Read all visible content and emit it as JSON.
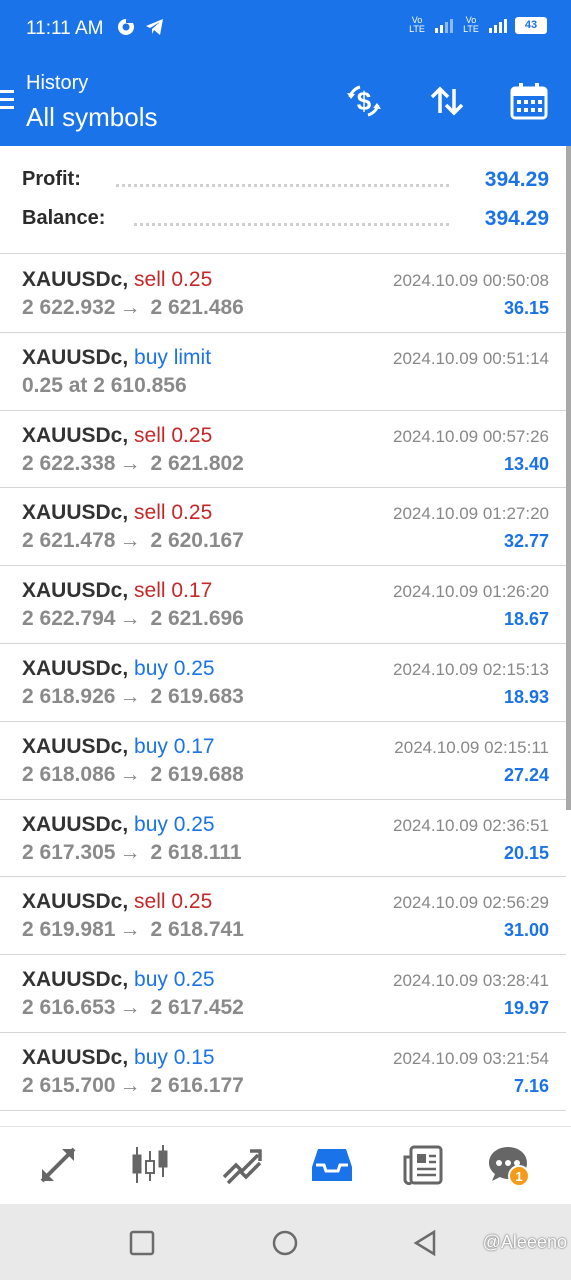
{
  "status_bar": {
    "time": "11:11 AM",
    "volte1": "Vo LTE",
    "volte2": "Vo LTE",
    "battery": "43"
  },
  "header": {
    "subtitle": "History",
    "title": "All symbols",
    "actions": [
      "dollar-refresh-icon",
      "sort-icon",
      "calendar-icon"
    ]
  },
  "summary": {
    "profit_label": "Profit:",
    "profit_value": "394.29",
    "balance_label": "Balance:",
    "balance_value": "394.29"
  },
  "trades": [
    {
      "symbol": "XAUUSDc",
      "side": "sell",
      "detail": "sell 0.25",
      "open": "2 622.932",
      "close": "2 621.486",
      "time": "2024.10.09 00:50:08",
      "profit": "36.15"
    },
    {
      "symbol": "XAUUSDc",
      "side": "buy",
      "detail": "buy limit",
      "line2": "0.25 at 2 610.856",
      "time": "2024.10.09 00:51:14",
      "profit": ""
    },
    {
      "symbol": "XAUUSDc",
      "side": "sell",
      "detail": "sell 0.25",
      "open": "2 622.338",
      "close": "2 621.802",
      "time": "2024.10.09 00:57:26",
      "profit": "13.40"
    },
    {
      "symbol": "XAUUSDc",
      "side": "sell",
      "detail": "sell 0.25",
      "open": "2 621.478",
      "close": "2 620.167",
      "time": "2024.10.09 01:27:20",
      "profit": "32.77"
    },
    {
      "symbol": "XAUUSDc",
      "side": "sell",
      "detail": "sell 0.17",
      "open": "2 622.794",
      "close": "2 621.696",
      "time": "2024.10.09 01:26:20",
      "profit": "18.67"
    },
    {
      "symbol": "XAUUSDc",
      "side": "buy",
      "detail": "buy 0.25",
      "open": "2 618.926",
      "close": "2 619.683",
      "time": "2024.10.09 02:15:13",
      "profit": "18.93"
    },
    {
      "symbol": "XAUUSDc",
      "side": "buy",
      "detail": "buy 0.17",
      "open": "2 618.086",
      "close": "2 619.688",
      "time": "2024.10.09 02:15:11",
      "profit": "27.24"
    },
    {
      "symbol": "XAUUSDc",
      "side": "buy",
      "detail": "buy 0.25",
      "open": "2 617.305",
      "close": "2 618.111",
      "time": "2024.10.09 02:36:51",
      "profit": "20.15"
    },
    {
      "symbol": "XAUUSDc",
      "side": "sell",
      "detail": "sell 0.25",
      "open": "2 619.981",
      "close": "2 618.741",
      "time": "2024.10.09 02:56:29",
      "profit": "31.00"
    },
    {
      "symbol": "XAUUSDc",
      "side": "buy",
      "detail": "buy 0.25",
      "open": "2 616.653",
      "close": "2 617.452",
      "time": "2024.10.09 03:28:41",
      "profit": "19.97"
    },
    {
      "symbol": "XAUUSDc",
      "side": "buy",
      "detail": "buy 0.15",
      "open": "2 615.700",
      "close": "2 616.177",
      "time": "2024.10.09 03:21:54",
      "profit": "7.16"
    }
  ],
  "tabbar": {
    "tabs": [
      "quotes-arrows-icon",
      "candlestick-chart-icon",
      "trade-chart-icon",
      "history-inbox-icon",
      "news-icon",
      "chat-icon"
    ],
    "active_tab": "history-inbox-icon",
    "chat_badge": "1"
  },
  "navbar": {
    "watermark": "@Aleeeno"
  },
  "colors": {
    "primary": "#1a73e8",
    "sell": "#c62828",
    "buy": "#1a73e8",
    "badge": "#f59b1c"
  }
}
